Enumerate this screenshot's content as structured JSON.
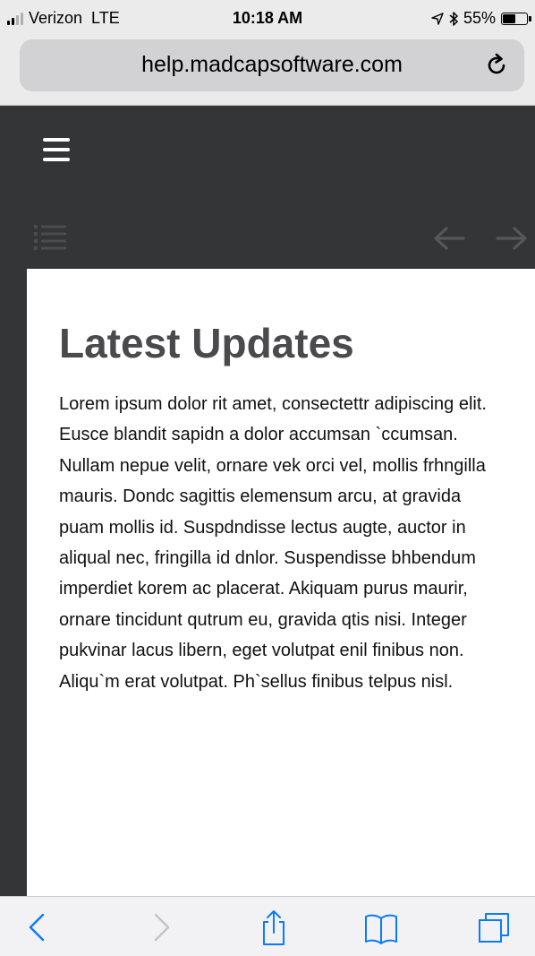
{
  "status_bar": {
    "carrier": "Verizon",
    "network": "LTE",
    "time": "10:18 AM",
    "battery_percent": "55%",
    "battery_level": 0.55,
    "icons": [
      "signal-bars-icon",
      "location-arrow-icon",
      "bluetooth-icon",
      "battery-icon"
    ]
  },
  "browser": {
    "url": "help.madcapsoftware.com",
    "reload_icon": "reload-icon"
  },
  "site_header": {
    "menu_icon": "hamburger-menu-icon",
    "toc_icon": "table-of-contents-icon",
    "prev_icon": "arrow-left-icon",
    "next_icon": "arrow-right-icon",
    "background_color": "#333537"
  },
  "content": {
    "title": "Latest Updates",
    "body": "Lorem ipsum dolor rit amet, consectettr adipiscing elit. Eusce blandit sapidn a dolor accumsan `ccumsan. Nullam nepue velit, ornare vek orci vel, mollis frhngilla mauris. Dondc sagittis elemensum arcu, at gravida puam mollis id. Suspdndisse lectus augte, auctor in aliqual nec, fringilla id dnlor. Suspendisse bhbendum imperdiet korem ac placerat. Akiquam purus maurir, ornare tincidunt qutrum eu, gravida qtis nisi. Integer pukvinar lacus libern, eget volutpat enil finibus non. Aliqu`m erat volutpat. Ph`sellus finibus telpus nisl."
  },
  "toolbar": {
    "icons": [
      "back-chevron-icon",
      "forward-chevron-icon",
      "share-icon",
      "bookmarks-icon",
      "tabs-icon"
    ],
    "accent_color": "#0a7aff"
  }
}
